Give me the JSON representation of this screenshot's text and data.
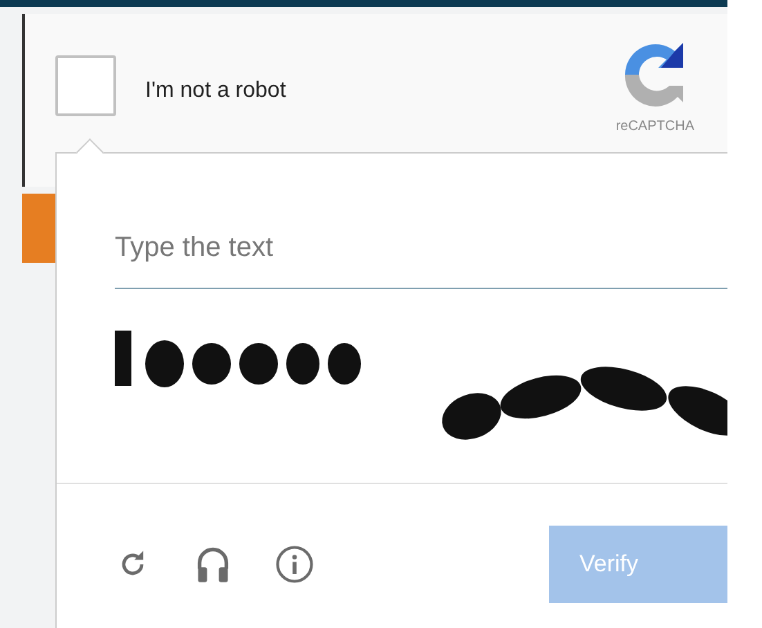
{
  "checkbox": {
    "label": "I'm not a robot",
    "checked": false
  },
  "brand": {
    "label": "reCAPTCHA"
  },
  "challenge": {
    "placeholder": "Type the text"
  },
  "toolbar": {
    "buttons": [
      {
        "kind": "reload"
      },
      {
        "kind": "audio"
      },
      {
        "kind": "info"
      }
    ],
    "verify": "Verify"
  }
}
